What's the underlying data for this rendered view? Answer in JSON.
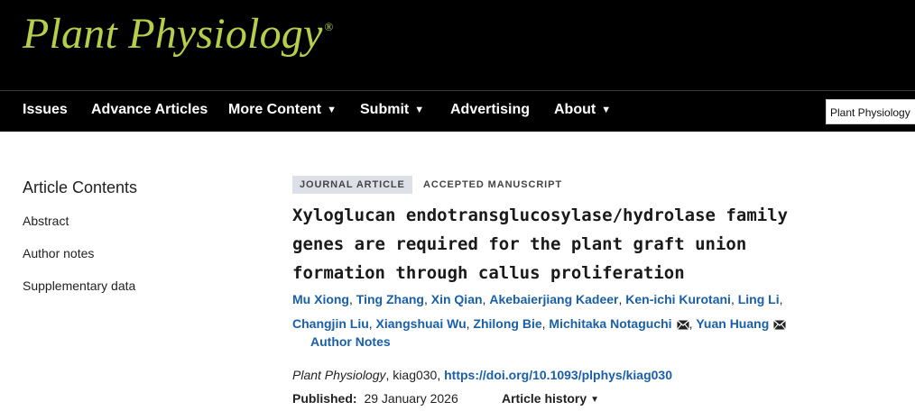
{
  "brand": {
    "name": "Plant Physiology",
    "mark": "®"
  },
  "nav": {
    "items": [
      {
        "label": "Issues",
        "dropdown": false
      },
      {
        "label": "Advance Articles",
        "dropdown": false
      },
      {
        "label": "More Content",
        "dropdown": true
      },
      {
        "label": "Submit",
        "dropdown": true
      },
      {
        "label": "Advertising",
        "dropdown": false
      },
      {
        "label": "About",
        "dropdown": true
      }
    ],
    "journal_select": "Plant Physiology"
  },
  "toc": {
    "title": "Article Contents",
    "items": [
      "Abstract",
      "Author notes",
      "Supplementary data"
    ]
  },
  "article": {
    "type_badge": "JOURNAL ARTICLE",
    "status_badge": "ACCEPTED MANUSCRIPT",
    "title_lines": [
      "Xyloglucan endotransglucosylase/hydrolase family",
      "genes are required for the plant graft union",
      "formation through callus proliferation"
    ],
    "authors": [
      {
        "name": "Mu Xiong",
        "email": false
      },
      {
        "name": "Ting Zhang",
        "email": false
      },
      {
        "name": "Xin Qian",
        "email": false
      },
      {
        "name": "Akebaierjiang Kadeer",
        "email": false
      },
      {
        "name": "Ken-ichi Kurotani",
        "email": false
      },
      {
        "name": "Ling Li",
        "email": false
      },
      {
        "name": "Changjin Liu",
        "email": false
      },
      {
        "name": "Xiangshuai Wu",
        "email": false
      },
      {
        "name": "Zhilong Bie",
        "email": false
      },
      {
        "name": "Michitaka Notaguchi",
        "email": true
      },
      {
        "name": "Yuan Huang",
        "email": true
      }
    ],
    "author_notes": "Author Notes",
    "citation": {
      "journal": "Plant Physiology",
      "id": ", kiag030, ",
      "doi": "https://doi.org/10.1093/plphys/kiag030"
    },
    "published_label": "Published:",
    "published_date": "29 January 2026",
    "history_label": "Article history"
  },
  "colors": {
    "brand_green": "#b5cf4b",
    "link_blue": "#1a5fa8",
    "header_bg": "#000000"
  },
  "icons": {
    "dropdown": "caret-down-icon",
    "email": "envelope-icon"
  }
}
